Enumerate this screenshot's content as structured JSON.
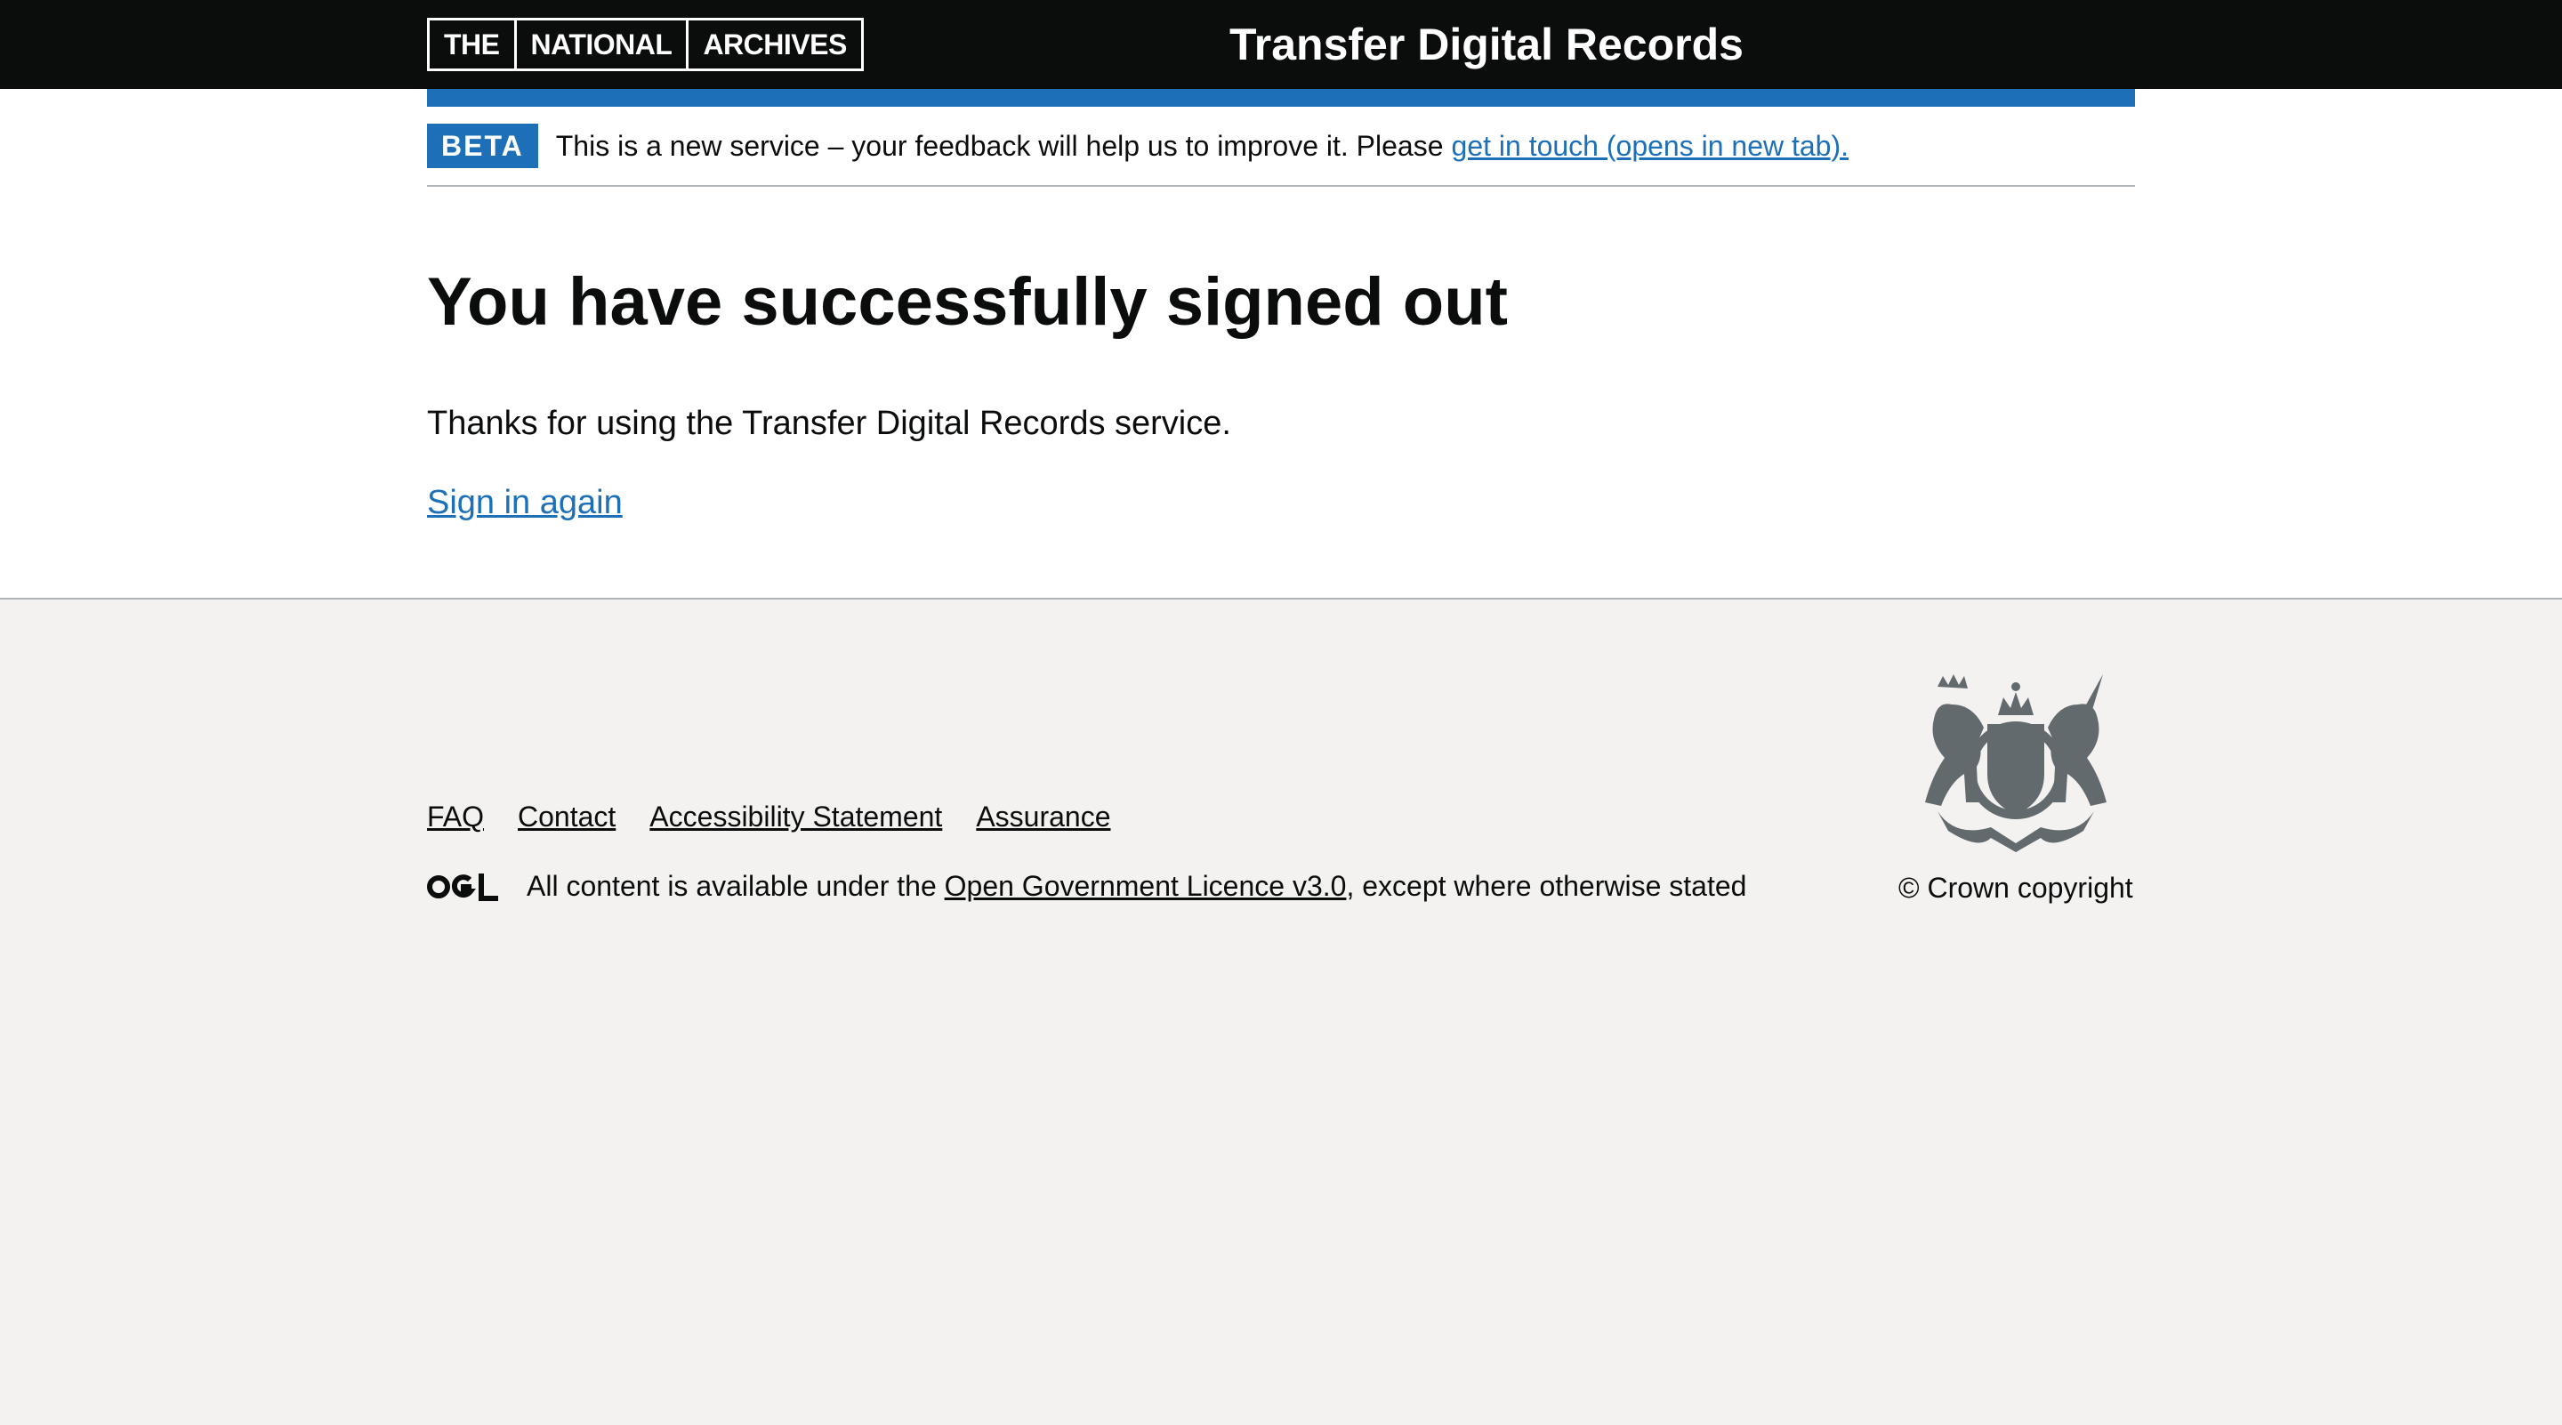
{
  "header": {
    "logo_parts": [
      "THE",
      "NATIONAL",
      "ARCHIVES"
    ],
    "service_name": "Transfer Digital Records"
  },
  "phase_banner": {
    "tag": "BETA",
    "text": "This is a new service – your feedback will help us to improve it. Please",
    "link": "get in touch (opens in new tab)."
  },
  "main": {
    "title": "You have successfully signed out",
    "body": "Thanks for using the Transfer Digital Records service.",
    "sign_in_link": "Sign in again"
  },
  "footer": {
    "links": [
      "FAQ",
      "Contact",
      "Accessibility Statement",
      "Assurance"
    ],
    "licence_prefix": "All content is available under the",
    "licence_link": "Open Government Licence v3.0",
    "licence_suffix": ", except where otherwise stated",
    "copyright": "© Crown copyright"
  },
  "colors": {
    "header_bg": "#0b0c0c",
    "accent": "#1d70b8",
    "footer_bg": "#f3f2f1",
    "crest": "#626a6e"
  }
}
